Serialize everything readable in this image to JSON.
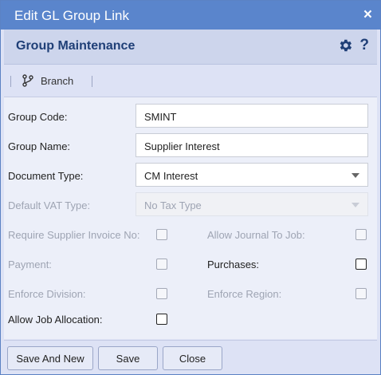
{
  "window": {
    "title": "Edit GL Group Link",
    "close_icon": "×"
  },
  "header": {
    "title": "Group Maintenance",
    "gear_icon": "gear-icon",
    "help_icon": "?"
  },
  "toolbar": {
    "branch_label": "Branch",
    "branch_icon": "branch-icon"
  },
  "form": {
    "group_code": {
      "label": "Group Code:",
      "value": "SMINT"
    },
    "group_name": {
      "label": "Group Name:",
      "value": "Supplier Interest"
    },
    "document_type": {
      "label": "Document Type:",
      "value": "CM Interest"
    },
    "default_vat_type": {
      "label": "Default VAT Type:",
      "value": "No Tax Type"
    },
    "require_supplier_invoice_no": {
      "label": "Require Supplier Invoice No:",
      "checked": false
    },
    "allow_journal_to_job": {
      "label": "Allow Journal To Job:",
      "checked": false
    },
    "payment": {
      "label": "Payment:",
      "checked": false
    },
    "purchases": {
      "label": "Purchases:",
      "checked": false
    },
    "enforce_division": {
      "label": "Enforce Division:",
      "checked": false
    },
    "enforce_region": {
      "label": "Enforce Region:",
      "checked": false
    },
    "allow_job_allocation": {
      "label": "Allow Job Allocation:",
      "checked": false
    }
  },
  "footer": {
    "save_and_new": "Save And New",
    "save": "Save",
    "close": "Close"
  },
  "colors": {
    "titlebar": "#5a85cc",
    "header_text": "#1f3f77",
    "dialog_bg": "#dde2f5",
    "content_bg": "#eceff9"
  }
}
